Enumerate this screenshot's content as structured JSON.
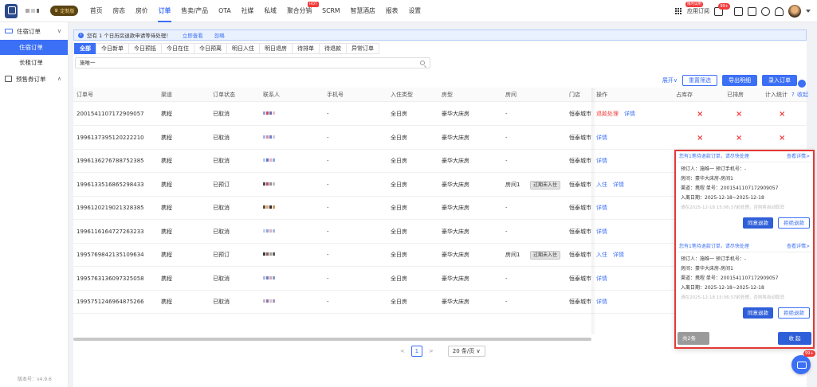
{
  "header": {
    "brand_badge": "定制版",
    "nav": [
      {
        "label": "首页"
      },
      {
        "label": "房态"
      },
      {
        "label": "房价"
      },
      {
        "label": "订单",
        "active": true
      },
      {
        "label": "售卖/产品"
      },
      {
        "label": "OTA"
      },
      {
        "label": "社媒"
      },
      {
        "label": "私域"
      },
      {
        "label": "聚合分销",
        "hot": "HOT"
      },
      {
        "label": "SCRM"
      },
      {
        "label": "智慧酒店"
      },
      {
        "label": "报表"
      },
      {
        "label": "设置"
      }
    ],
    "app_label": "应用订阅",
    "limit_tag": "限时试用",
    "message_count": "99+"
  },
  "sidebar": {
    "groups": [
      {
        "label": "住宿订单",
        "arrow": "∨",
        "items": [
          {
            "label": "住宿订单",
            "active": true
          },
          {
            "label": "长租订单"
          }
        ]
      },
      {
        "label": "预售券订单",
        "arrow": "∧",
        "items": []
      }
    ],
    "version": "版本号：v4.9.6"
  },
  "notice": {
    "text": "您有 1 个日历房退款申请等待处理！",
    "view_link": "立即查看",
    "ignore_link": "忽略"
  },
  "tabs": [
    "全部",
    "今日新单",
    "今日预抵",
    "今日在住",
    "今日预离",
    "明日入住",
    "明日退房",
    "待排单",
    "待退款",
    "异常订单"
  ],
  "search": {
    "value": "施唯一"
  },
  "actions": {
    "expand": "展开∨",
    "reset": "重置筛选",
    "export": "导出明细",
    "entry": "录入订单"
  },
  "table": {
    "headers": [
      "订单号",
      "渠道",
      "订单状态",
      "联系人",
      "手机号",
      "入住类型",
      "房型",
      "房间",
      "门店",
      "操作",
      "占库存",
      "已排房",
      "计入统计"
    ],
    "stat_help": "?",
    "collect": "收起",
    "rows": [
      {
        "id": "2001541107172909057",
        "channel": "携程",
        "status": "已取消",
        "phone": "-",
        "type": "全日房",
        "room_type": "豪华大床房",
        "room": "-",
        "store": "恒泰城市",
        "ops": [
          {
            "label": "退款处理",
            "style": "danger"
          },
          {
            "label": "详情",
            "style": "link"
          }
        ],
        "x": [
          "×",
          "×",
          "×"
        ]
      },
      {
        "id": "1996137395120222210",
        "channel": "携程",
        "status": "已取消",
        "phone": "-",
        "type": "全日房",
        "room_type": "豪华大床房",
        "room": "-",
        "store": "恒泰城市",
        "ops": [
          {
            "label": "详情",
            "style": "link"
          }
        ],
        "x": [
          "×",
          "×",
          "×"
        ]
      },
      {
        "id": "1996136276788752385",
        "channel": "携程",
        "status": "已取消",
        "phone": "-",
        "type": "全日房",
        "room_type": "豪华大床房",
        "room": "-",
        "store": "恒泰城市",
        "ops": [
          {
            "label": "详情",
            "style": "link"
          }
        ],
        "x": []
      },
      {
        "id": "1996133516865298433",
        "channel": "携程",
        "status": "已预订",
        "phone": "-",
        "type": "全日房",
        "room_type": "豪华大床房",
        "room": "房间1",
        "room_tag": "过期未入住",
        "store": "恒泰城市",
        "ops": [
          {
            "label": "入住",
            "style": "link"
          },
          {
            "label": "详情",
            "style": "link"
          }
        ],
        "x": []
      },
      {
        "id": "1996120219021328385",
        "channel": "携程",
        "status": "已取消",
        "phone": "-",
        "type": "全日房",
        "room_type": "豪华大床房",
        "room": "-",
        "store": "恒泰城市",
        "ops": [
          {
            "label": "详情",
            "style": "link"
          }
        ],
        "x": []
      },
      {
        "id": "1996116164727263233",
        "channel": "携程",
        "status": "已取消",
        "phone": "-",
        "type": "全日房",
        "room_type": "豪华大床房",
        "room": "-",
        "store": "恒泰城市",
        "ops": [
          {
            "label": "详情",
            "style": "link"
          }
        ],
        "x": []
      },
      {
        "id": "1995769842135109634",
        "channel": "携程",
        "status": "已预订",
        "phone": "-",
        "type": "全日房",
        "room_type": "豪华大床房",
        "room": "房间1",
        "room_tag": "过期未入住",
        "store": "恒泰城市",
        "ops": [
          {
            "label": "入住",
            "style": "link"
          },
          {
            "label": "详情",
            "style": "link"
          }
        ],
        "x": []
      },
      {
        "id": "1995763136097325058",
        "channel": "携程",
        "status": "已取消",
        "phone": "-",
        "type": "全日房",
        "room_type": "豪华大床房",
        "room": "-",
        "store": "恒泰城市",
        "ops": [
          {
            "label": "详情",
            "style": "link"
          }
        ],
        "x": []
      },
      {
        "id": "1995751246964875266",
        "channel": "携程",
        "status": "已取消",
        "phone": "-",
        "type": "全日房",
        "room_type": "豪华大床房",
        "room": "-",
        "store": "恒泰城市",
        "ops": [
          {
            "label": "详情",
            "style": "link"
          }
        ],
        "x": []
      }
    ]
  },
  "pagination": {
    "prev": "<",
    "page": "1",
    "next": ">",
    "size": "20 条/页"
  },
  "popup": {
    "cards": [
      {
        "title": "您有1笔待退款订单，请尽快处理",
        "more": "查看详情>",
        "booker": "预订人：施唯一  预订手机号：-",
        "room": "房间：豪华大床房-房间1",
        "channel": "渠道：携程   单号：2001541107172909057",
        "dates": "入离日期：2025-12-18~2025-12-18",
        "warn": "请在2025-12-18 15:06:37前处理，否则将自动取消",
        "agree": "同意退款",
        "reject": "拒绝退款"
      },
      {
        "title": "您有1笔待退款订单，请尽快处理",
        "more": "查看详情>",
        "booker": "预订人：施唯一  预订手机号：-",
        "room": "房间：豪华大床房-房间1",
        "channel": "渠道：携程   单号：2001541107172909057",
        "dates": "入离日期：2025-12-18~2025-12-18",
        "warn": "请在2025-12-18 15:06:37前处理，否则将自动取消",
        "agree": "同意退款",
        "reject": "拒绝退款"
      }
    ],
    "total": "共2条",
    "collapse": "收 起"
  },
  "chat_badge": "99+",
  "colors": {
    "accent": "#3b6ff5",
    "danger": "#f23b3b",
    "popup_border": "#e53935"
  }
}
